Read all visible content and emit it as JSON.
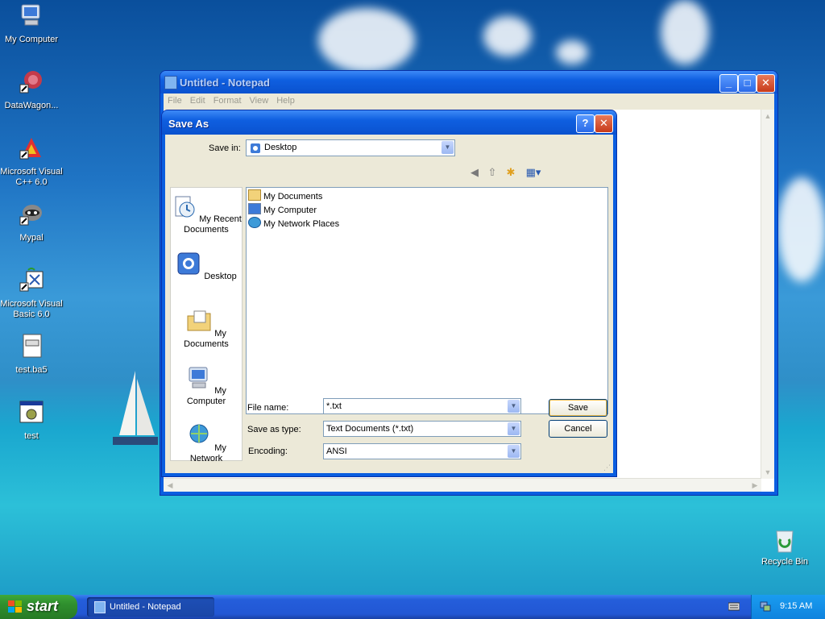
{
  "desktop": {
    "icons": [
      {
        "label": "My Computer",
        "icon": "my-computer-icon"
      },
      {
        "label": "DataWagon...",
        "icon": "datawagon-icon"
      },
      {
        "label": "Microsoft Visual C++ 6.0",
        "icon": "visual-cpp-icon"
      },
      {
        "label": "Mypal",
        "icon": "mypal-icon"
      },
      {
        "label": "Microsoft Visual Basic 6.0",
        "icon": "visual-basic-icon"
      },
      {
        "label": "test.ba5",
        "icon": "document-icon"
      },
      {
        "label": "test",
        "icon": "application-icon"
      }
    ],
    "recycle_bin": "Recycle Bin"
  },
  "notepad": {
    "title": "Untitled - Notepad",
    "menu": [
      "File",
      "Edit",
      "Format",
      "View",
      "Help"
    ],
    "controls": {
      "minimize": "_",
      "maximize": "□",
      "close": "✕"
    }
  },
  "save_dialog": {
    "title": "Save As",
    "save_in_label": "Save in:",
    "save_in_value": "Desktop",
    "places": [
      "My Recent Documents",
      "Desktop",
      "My Documents",
      "My Computer",
      "My Network"
    ],
    "files": [
      "My Documents",
      "My Computer",
      "My Network Places"
    ],
    "file_name_label": "File name:",
    "file_name_value": "*.txt",
    "save_as_type_label": "Save as type:",
    "save_as_type_value": "Text Documents (*.txt)",
    "encoding_label": "Encoding:",
    "encoding_value": "ANSI",
    "save_button": "Save",
    "cancel_button": "Cancel",
    "help_button": "?",
    "close_button": "✕"
  },
  "taskbar": {
    "start_label": "start",
    "tasks": [
      "Untitled - Notepad"
    ],
    "clock": "9:15 AM"
  },
  "colors": {
    "xp_blue": "#0a5ee0",
    "dialog_face": "#ece9d8",
    "start_green": "#2f8f2e"
  }
}
